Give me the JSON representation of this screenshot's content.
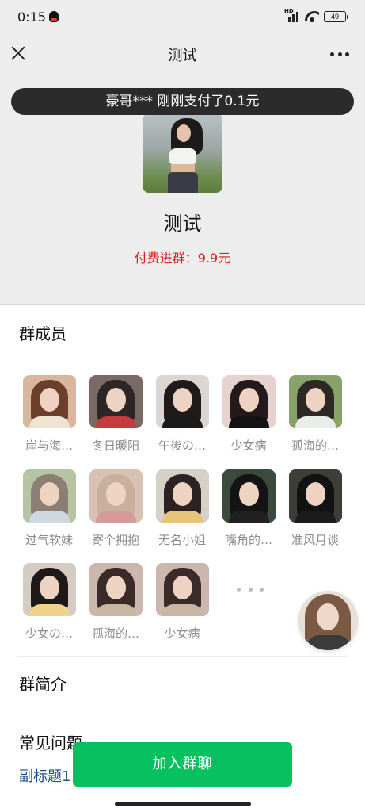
{
  "status_bar": {
    "time": "0:15",
    "network": "HD",
    "battery": "49"
  },
  "nav": {
    "title": "测试"
  },
  "banner": {
    "text": "豪哥*** 刚刚支付了0.1元"
  },
  "group": {
    "name": "测试",
    "fee": "付费进群：9.9元"
  },
  "members_section": {
    "title": "群成员",
    "members": [
      {
        "name": "岸与海…"
      },
      {
        "name": "冬日暖阳"
      },
      {
        "name": "午後の…"
      },
      {
        "name": "少女病"
      },
      {
        "name": "孤海的…"
      },
      {
        "name": "过气软妹"
      },
      {
        "name": "寄个拥抱"
      },
      {
        "name": "无名小姐"
      },
      {
        "name": "嘴角的…"
      },
      {
        "name": "准风月谈"
      },
      {
        "name": "少女の…"
      },
      {
        "name": "孤海的…"
      },
      {
        "name": "少女病"
      }
    ]
  },
  "intro_section": {
    "title": "群简介"
  },
  "faq_section": {
    "title": "常见问题",
    "subtitle": "副标题1"
  },
  "join_button": {
    "label": "加入群聊"
  },
  "colors": {
    "accent": "#07c160",
    "fee_red": "#d81e1e",
    "link_blue": "#1d4d86",
    "banner_bg": "#2b2b2b"
  }
}
